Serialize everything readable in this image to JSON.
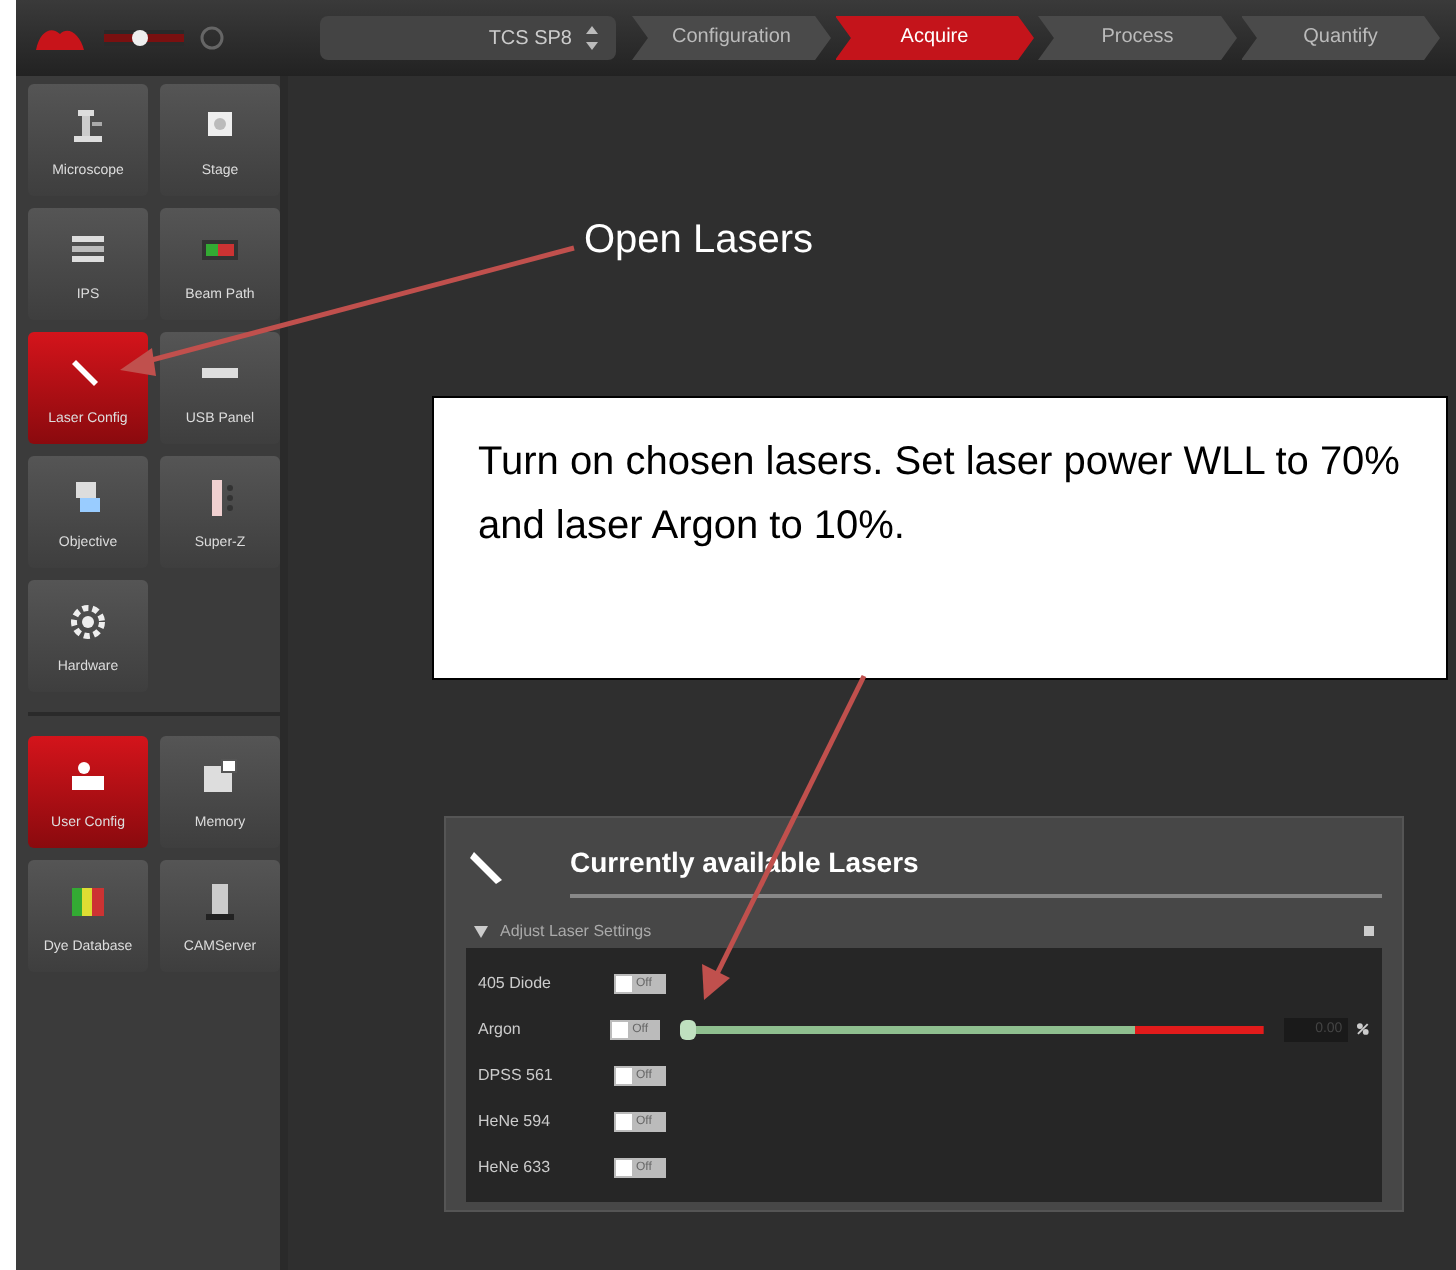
{
  "top_bar": {
    "zoom": {
      "level": 0.45
    },
    "system": "TCS SP8",
    "steps": [
      {
        "label": "Configuration",
        "selected": false
      },
      {
        "label": "Acquire",
        "selected": true
      },
      {
        "label": "Process",
        "selected": false
      },
      {
        "label": "Quantify",
        "selected": false
      }
    ]
  },
  "sidebar": {
    "groups": [
      {
        "items": [
          {
            "label": "Microscope",
            "selected": false
          },
          {
            "label": "Stage",
            "selected": false
          },
          {
            "label": "IPS",
            "selected": false
          },
          {
            "label": "Beam Path",
            "selected": false
          },
          {
            "label": "Laser Config",
            "selected": true
          },
          {
            "label": "USB Panel",
            "selected": false
          },
          {
            "label": "Objective",
            "selected": false
          },
          {
            "label": "Super-Z",
            "selected": false
          },
          {
            "label": "Hardware",
            "selected": false
          }
        ]
      },
      {
        "items": [
          {
            "label": "User Config",
            "selected": true
          },
          {
            "label": "Memory",
            "selected": false
          },
          {
            "label": "Dye Database",
            "selected": false
          },
          {
            "label": "CAMServer",
            "selected": false
          }
        ]
      }
    ]
  },
  "annotations": [
    {
      "kind": "label",
      "text": "Open Lasers"
    },
    {
      "kind": "box",
      "text": "Turn on chosen lasers. Set laser power WLL to 70% and laser Argon to 10%."
    }
  ],
  "laser_panel": {
    "title": "Currently available Lasers",
    "section": {
      "label": "Adjust Laser Settings",
      "expanded": true
    },
    "lasers": [
      {
        "name": "405 Diode",
        "toggle": "Off",
        "on": false
      },
      {
        "name": "Argon",
        "toggle": "Off",
        "on": false,
        "power": {
          "level": 0,
          "value": "0.00"
        }
      },
      {
        "name": "DPSS 561",
        "toggle": "Off",
        "on": false
      },
      {
        "name": "HeNe 594",
        "toggle": "Off",
        "on": false
      },
      {
        "name": "HeNe 633",
        "toggle": "Off",
        "on": false
      }
    ]
  }
}
